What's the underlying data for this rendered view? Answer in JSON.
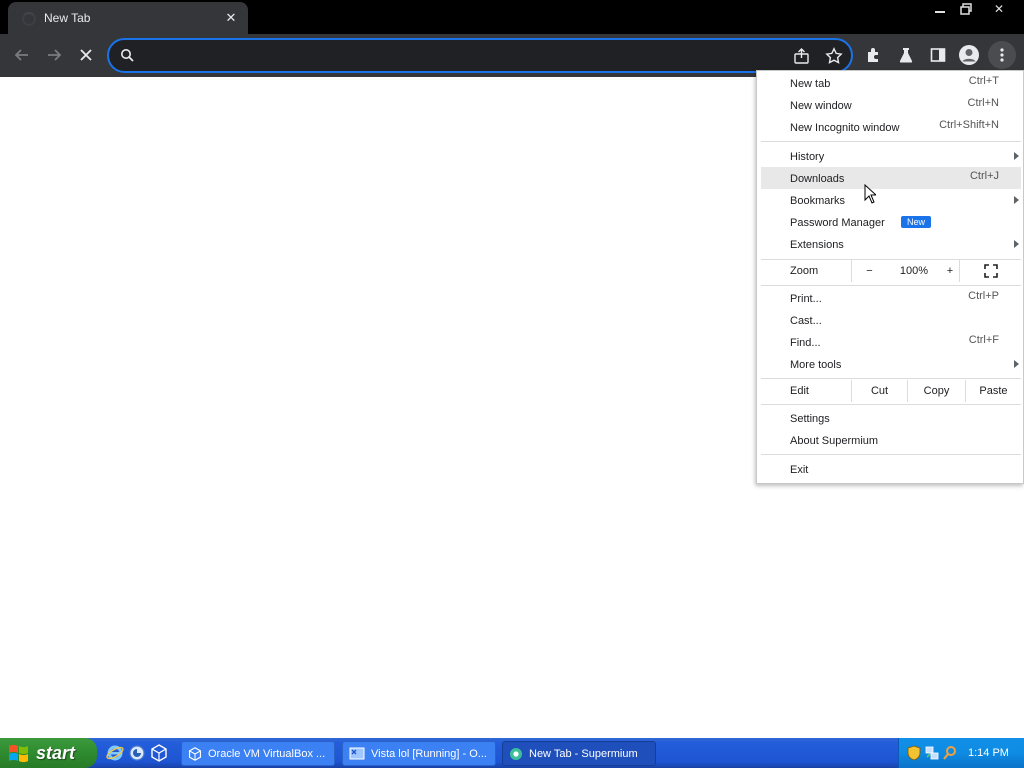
{
  "browser": {
    "tab_title": "New Tab",
    "omnibox_value": "",
    "menu": {
      "items": [
        {
          "label": "New tab",
          "shortcut": "Ctrl+T"
        },
        {
          "label": "New window",
          "shortcut": "Ctrl+N"
        },
        {
          "label": "New Incognito window",
          "shortcut": "Ctrl+Shift+N"
        },
        {
          "label": "History"
        },
        {
          "label": "Downloads",
          "shortcut": "Ctrl+J"
        },
        {
          "label": "Bookmarks"
        },
        {
          "label": "Password Manager",
          "badge": "New"
        },
        {
          "label": "Extensions"
        },
        {
          "label": "Print...",
          "shortcut": "Ctrl+P"
        },
        {
          "label": "Cast..."
        },
        {
          "label": "Find...",
          "shortcut": "Ctrl+F"
        },
        {
          "label": "More tools"
        },
        {
          "label": "Settings"
        },
        {
          "label": "About Supermium"
        },
        {
          "label": "Exit"
        }
      ],
      "zoom": {
        "label": "Zoom",
        "minus": "−",
        "value": "100%",
        "plus": "+"
      },
      "edit": {
        "label": "Edit",
        "cut": "Cut",
        "copy": "Copy",
        "paste": "Paste"
      }
    }
  },
  "taskbar": {
    "start_label": "start",
    "tasks": [
      {
        "label": "Oracle VM VirtualBox ..."
      },
      {
        "label": "Vista lol [Running] - O..."
      },
      {
        "label": "New Tab - Supermium"
      }
    ],
    "clock": "1:14 PM"
  },
  "colors": {
    "accent": "#1a73e8",
    "toolbar": "#35363a",
    "taskbar": "#245edb",
    "start": "#2f8b2f"
  }
}
